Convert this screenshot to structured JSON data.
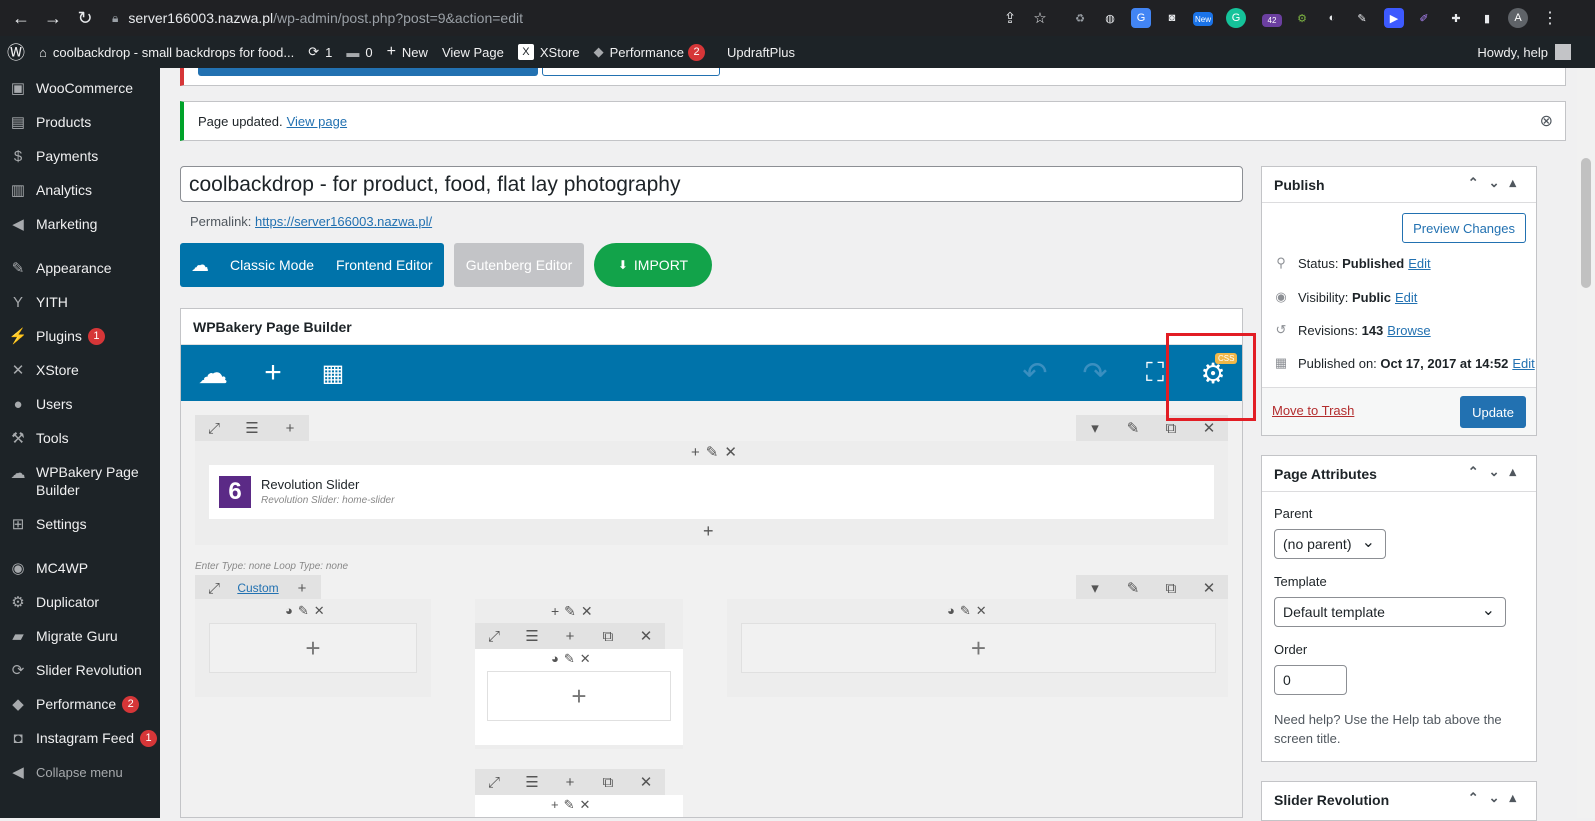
{
  "browser": {
    "url_host": "server166003.nazwa.pl",
    "url_path": "/wp-admin/post.php?post=9&action=edit",
    "ext_badge_new": "New",
    "ext_badge_42": "42",
    "profile_initial": "A"
  },
  "adminbar": {
    "site_name": "coolbackdrop - small backdrops for food...",
    "updates_count": "1",
    "comments_count": "0",
    "new_label": "New",
    "view_page": "View Page",
    "xstore": "XStore",
    "performance": "Performance",
    "performance_count": "2",
    "updraft": "UpdraftPlus",
    "howdy": "Howdy, help"
  },
  "sidebar": {
    "items": [
      {
        "label": "WooCommerce",
        "badge": ""
      },
      {
        "label": "Products",
        "badge": ""
      },
      {
        "label": "Payments",
        "badge": ""
      },
      {
        "label": "Analytics",
        "badge": ""
      },
      {
        "label": "Marketing",
        "badge": ""
      },
      {
        "label": "Appearance",
        "badge": ""
      },
      {
        "label": "YITH",
        "badge": ""
      },
      {
        "label": "Plugins",
        "badge": "1"
      },
      {
        "label": "XStore",
        "badge": ""
      },
      {
        "label": "Users",
        "badge": ""
      },
      {
        "label": "Tools",
        "badge": ""
      },
      {
        "label": "WPBakery Page",
        "badge": ""
      },
      {
        "label": "Builder",
        "badge": ""
      },
      {
        "label": "Settings",
        "badge": ""
      },
      {
        "label": "MC4WP",
        "badge": ""
      },
      {
        "label": "Duplicator",
        "badge": ""
      },
      {
        "label": "Migrate Guru",
        "badge": ""
      },
      {
        "label": "Slider Revolution",
        "badge": ""
      },
      {
        "label": "Performance",
        "badge": "2"
      },
      {
        "label": "Instagram Feed",
        "badge": "1"
      },
      {
        "label": "Collapse menu",
        "badge": ""
      }
    ]
  },
  "notice": {
    "text": "Page updated.",
    "link": "View page"
  },
  "editor": {
    "title_value": "coolbackdrop - for product, food, flat lay photography",
    "permalink_label": "Permalink:",
    "permalink_url": "https://server166003.nazwa.pl/",
    "classic_mode": "Classic Mode",
    "frontend_editor": "Frontend Editor",
    "gutenberg_editor": "Gutenberg Editor",
    "import": "IMPORT"
  },
  "wpbakery": {
    "title": "WPBakery Page Builder",
    "css_badge": "CSS",
    "element_title": "Revolution Slider",
    "element_sub": "Revolution Slider: home-slider",
    "row_meta": "Enter Type: none  Loop Type: none",
    "custom_label": "Custom"
  },
  "publish": {
    "title": "Publish",
    "preview": "Preview Changes",
    "status_label": "Status:",
    "status_value": "Published",
    "visibility_label": "Visibility:",
    "visibility_value": "Public",
    "revisions_label": "Revisions:",
    "revisions_value": "143",
    "browse": "Browse",
    "published_label": "Published on:",
    "published_value": "Oct 17, 2017 at 14:52",
    "edit": "Edit",
    "trash": "Move to Trash",
    "update": "Update"
  },
  "attributes": {
    "title": "Page Attributes",
    "parent_label": "Parent",
    "parent_value": "(no parent)",
    "template_label": "Template",
    "template_value": "Default template",
    "order_label": "Order",
    "order_value": "0",
    "help": "Need help? Use the Help tab above the screen title."
  },
  "slider_box": {
    "title": "Slider Revolution"
  }
}
